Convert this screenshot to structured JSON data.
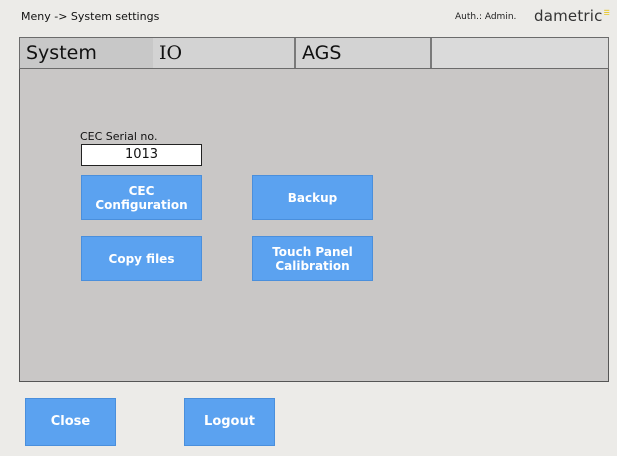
{
  "header": {
    "breadcrumb": "Meny -> System settings",
    "auth": "Auth.: Admin.",
    "logo_text": "dametric",
    "logo_mark": "☰"
  },
  "tabs": [
    {
      "label": "System",
      "active": true
    },
    {
      "label": "IO",
      "active": false
    },
    {
      "label": "AGS",
      "active": false
    },
    {
      "label": "",
      "active": false
    }
  ],
  "panel": {
    "serial_label": "CEC Serial no.",
    "serial_value": "1013",
    "buttons": {
      "cec_config": "CEC Configuration",
      "backup": "Backup",
      "copy_files": "Copy files",
      "touch_panel": "Touch Panel Calibration"
    }
  },
  "footer": {
    "close": "Close",
    "logout": "Logout"
  },
  "colors": {
    "button": "#5ba2f0",
    "panel": "#c9c7c6",
    "background": "#ecebe8"
  }
}
